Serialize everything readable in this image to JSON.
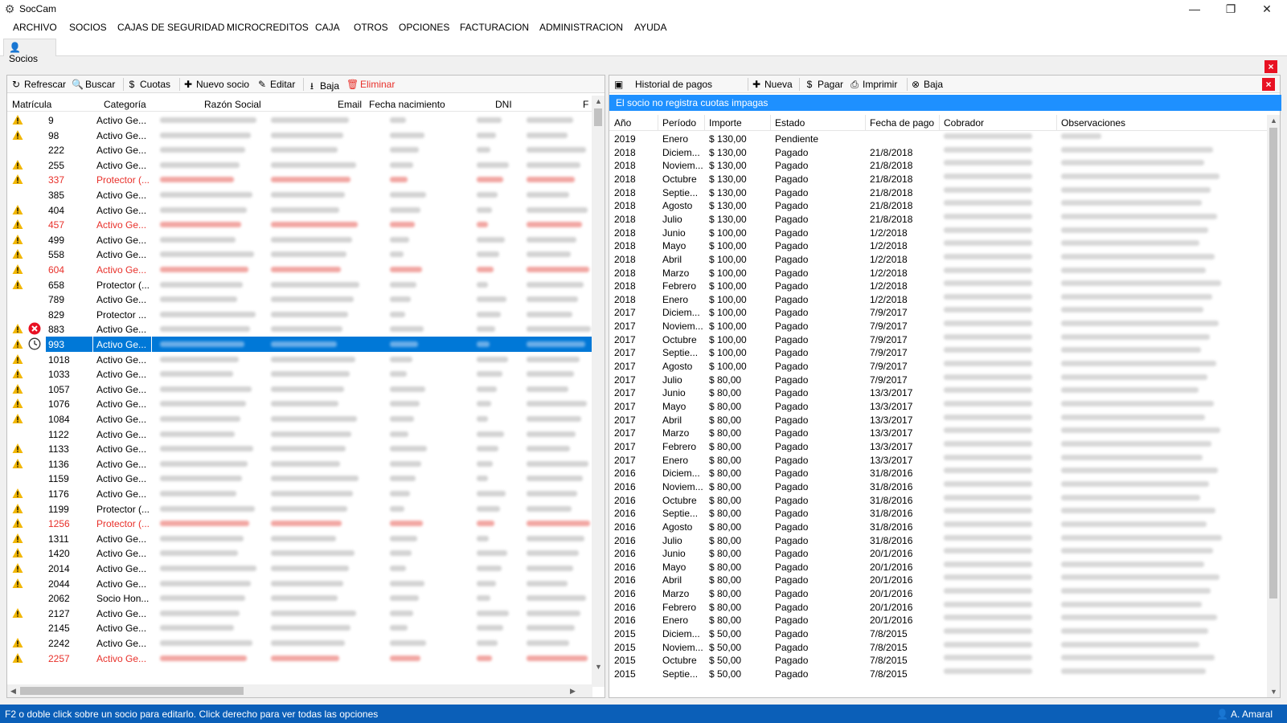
{
  "window": {
    "title": "SocCam",
    "minimize": "—",
    "restore": "❐",
    "close": "✕"
  },
  "menu": [
    "ARCHIVO",
    "SOCIOS",
    "CAJAS DE SEGURIDAD",
    "MICROCREDITOS",
    "CAJA",
    "OTROS",
    "OPCIONES",
    "FACTURACION",
    "ADMINISTRACION",
    "AYUDA"
  ],
  "tab": {
    "label": "Socios",
    "icon": "user-icon"
  },
  "left": {
    "toolbar": {
      "refresh": "Refrescar",
      "search": "Buscar",
      "fees": "Cuotas",
      "new": "Nuevo socio",
      "edit": "Editar",
      "deactivate": "Baja",
      "delete": "Eliminar"
    },
    "columns": [
      "Matrícula",
      "Categoría",
      "Razón Social",
      "Email",
      "Fecha nacimiento",
      "DNI",
      "F"
    ],
    "rows": [
      {
        "mat": "9",
        "cat": "Activo Ge...",
        "warn": true,
        "red": false,
        "extra": ""
      },
      {
        "mat": "98",
        "cat": "Activo Ge...",
        "warn": true,
        "red": false,
        "extra": ""
      },
      {
        "mat": "222",
        "cat": "Activo Ge...",
        "warn": false,
        "red": false,
        "extra": ""
      },
      {
        "mat": "255",
        "cat": "Activo Ge...",
        "warn": true,
        "red": false,
        "extra": ""
      },
      {
        "mat": "337",
        "cat": "Protector (...",
        "warn": true,
        "red": true,
        "extra": ""
      },
      {
        "mat": "385",
        "cat": "Activo Ge...",
        "warn": false,
        "red": false,
        "extra": ""
      },
      {
        "mat": "404",
        "cat": "Activo Ge...",
        "warn": true,
        "red": false,
        "extra": ""
      },
      {
        "mat": "457",
        "cat": "Activo Ge...",
        "warn": true,
        "red": true,
        "extra": ""
      },
      {
        "mat": "499",
        "cat": "Activo Ge...",
        "warn": true,
        "red": false,
        "extra": ""
      },
      {
        "mat": "558",
        "cat": "Activo Ge...",
        "warn": true,
        "red": false,
        "extra": ""
      },
      {
        "mat": "604",
        "cat": "Activo Ge...",
        "warn": true,
        "red": true,
        "extra": ""
      },
      {
        "mat": "658",
        "cat": "Protector (...",
        "warn": true,
        "red": false,
        "extra": ""
      },
      {
        "mat": "789",
        "cat": "Activo Ge...",
        "warn": false,
        "red": false,
        "extra": ""
      },
      {
        "mat": "829",
        "cat": "Protector ...",
        "warn": false,
        "red": false,
        "extra": ""
      },
      {
        "mat": "883",
        "cat": "Activo Ge...",
        "warn": true,
        "red": false,
        "extra": "error"
      },
      {
        "mat": "993",
        "cat": "Activo Ge...",
        "warn": true,
        "red": false,
        "extra": "clock",
        "selected": true
      },
      {
        "mat": "1018",
        "cat": "Activo Ge...",
        "warn": true,
        "red": false,
        "extra": ""
      },
      {
        "mat": "1033",
        "cat": "Activo Ge...",
        "warn": true,
        "red": false,
        "extra": ""
      },
      {
        "mat": "1057",
        "cat": "Activo Ge...",
        "warn": true,
        "red": false,
        "extra": ""
      },
      {
        "mat": "1076",
        "cat": "Activo Ge...",
        "warn": true,
        "red": false,
        "extra": ""
      },
      {
        "mat": "1084",
        "cat": "Activo Ge...",
        "warn": true,
        "red": false,
        "extra": ""
      },
      {
        "mat": "1122",
        "cat": "Activo Ge...",
        "warn": false,
        "red": false,
        "extra": ""
      },
      {
        "mat": "1133",
        "cat": "Activo Ge...",
        "warn": true,
        "red": false,
        "extra": ""
      },
      {
        "mat": "1136",
        "cat": "Activo Ge...",
        "warn": true,
        "red": false,
        "extra": ""
      },
      {
        "mat": "1159",
        "cat": "Activo Ge...",
        "warn": false,
        "red": false,
        "extra": ""
      },
      {
        "mat": "1176",
        "cat": "Activo Ge...",
        "warn": true,
        "red": false,
        "extra": ""
      },
      {
        "mat": "1199",
        "cat": "Protector (...",
        "warn": true,
        "red": false,
        "extra": ""
      },
      {
        "mat": "1256",
        "cat": "Protector (...",
        "warn": true,
        "red": true,
        "extra": ""
      },
      {
        "mat": "1311",
        "cat": "Activo Ge...",
        "warn": true,
        "red": false,
        "extra": ""
      },
      {
        "mat": "1420",
        "cat": "Activo Ge...",
        "warn": true,
        "red": false,
        "extra": ""
      },
      {
        "mat": "2014",
        "cat": "Activo Ge...",
        "warn": true,
        "red": false,
        "extra": ""
      },
      {
        "mat": "2044",
        "cat": "Activo Ge...",
        "warn": true,
        "red": false,
        "extra": ""
      },
      {
        "mat": "2062",
        "cat": "Socio Hon...",
        "warn": false,
        "red": false,
        "extra": ""
      },
      {
        "mat": "2127",
        "cat": "Activo Ge...",
        "warn": true,
        "red": false,
        "extra": ""
      },
      {
        "mat": "2145",
        "cat": "Activo Ge...",
        "warn": false,
        "red": false,
        "extra": ""
      },
      {
        "mat": "2242",
        "cat": "Activo Ge...",
        "warn": true,
        "red": false,
        "extra": ""
      },
      {
        "mat": "2257",
        "cat": "Activo Ge...",
        "warn": true,
        "red": true,
        "extra": ""
      }
    ]
  },
  "right": {
    "toolbar": {
      "title": "Historial de pagos",
      "new": "Nueva",
      "pay": "Pagar",
      "print": "Imprimir",
      "deactivate": "Baja"
    },
    "banner": "El socio no registra cuotas impagas",
    "columns": [
      "Año",
      "Período",
      "Importe",
      "Estado",
      "Fecha de pago",
      "Cobrador",
      "Observaciones"
    ],
    "rows": [
      [
        "2019",
        "Enero",
        "$ 130,00",
        "Pendiente",
        ""
      ],
      [
        "2018",
        "Diciem...",
        "$ 130,00",
        "Pagado",
        "21/8/2018"
      ],
      [
        "2018",
        "Noviem...",
        "$ 130,00",
        "Pagado",
        "21/8/2018"
      ],
      [
        "2018",
        "Octubre",
        "$ 130,00",
        "Pagado",
        "21/8/2018"
      ],
      [
        "2018",
        "Septie...",
        "$ 130,00",
        "Pagado",
        "21/8/2018"
      ],
      [
        "2018",
        "Agosto",
        "$ 130,00",
        "Pagado",
        "21/8/2018"
      ],
      [
        "2018",
        "Julio",
        "$ 130,00",
        "Pagado",
        "21/8/2018"
      ],
      [
        "2018",
        "Junio",
        "$ 100,00",
        "Pagado",
        "1/2/2018"
      ],
      [
        "2018",
        "Mayo",
        "$ 100,00",
        "Pagado",
        "1/2/2018"
      ],
      [
        "2018",
        "Abril",
        "$ 100,00",
        "Pagado",
        "1/2/2018"
      ],
      [
        "2018",
        "Marzo",
        "$ 100,00",
        "Pagado",
        "1/2/2018"
      ],
      [
        "2018",
        "Febrero",
        "$ 100,00",
        "Pagado",
        "1/2/2018"
      ],
      [
        "2018",
        "Enero",
        "$ 100,00",
        "Pagado",
        "1/2/2018"
      ],
      [
        "2017",
        "Diciem...",
        "$ 100,00",
        "Pagado",
        "7/9/2017"
      ],
      [
        "2017",
        "Noviem...",
        "$ 100,00",
        "Pagado",
        "7/9/2017"
      ],
      [
        "2017",
        "Octubre",
        "$ 100,00",
        "Pagado",
        "7/9/2017"
      ],
      [
        "2017",
        "Septie...",
        "$ 100,00",
        "Pagado",
        "7/9/2017"
      ],
      [
        "2017",
        "Agosto",
        "$ 100,00",
        "Pagado",
        "7/9/2017"
      ],
      [
        "2017",
        "Julio",
        "$ 80,00",
        "Pagado",
        "7/9/2017"
      ],
      [
        "2017",
        "Junio",
        "$ 80,00",
        "Pagado",
        "13/3/2017"
      ],
      [
        "2017",
        "Mayo",
        "$ 80,00",
        "Pagado",
        "13/3/2017"
      ],
      [
        "2017",
        "Abril",
        "$ 80,00",
        "Pagado",
        "13/3/2017"
      ],
      [
        "2017",
        "Marzo",
        "$ 80,00",
        "Pagado",
        "13/3/2017"
      ],
      [
        "2017",
        "Febrero",
        "$ 80,00",
        "Pagado",
        "13/3/2017"
      ],
      [
        "2017",
        "Enero",
        "$ 80,00",
        "Pagado",
        "13/3/2017"
      ],
      [
        "2016",
        "Diciem...",
        "$ 80,00",
        "Pagado",
        "31/8/2016"
      ],
      [
        "2016",
        "Noviem...",
        "$ 80,00",
        "Pagado",
        "31/8/2016"
      ],
      [
        "2016",
        "Octubre",
        "$ 80,00",
        "Pagado",
        "31/8/2016"
      ],
      [
        "2016",
        "Septie...",
        "$ 80,00",
        "Pagado",
        "31/8/2016"
      ],
      [
        "2016",
        "Agosto",
        "$ 80,00",
        "Pagado",
        "31/8/2016"
      ],
      [
        "2016",
        "Julio",
        "$ 80,00",
        "Pagado",
        "31/8/2016"
      ],
      [
        "2016",
        "Junio",
        "$ 80,00",
        "Pagado",
        "20/1/2016"
      ],
      [
        "2016",
        "Mayo",
        "$ 80,00",
        "Pagado",
        "20/1/2016"
      ],
      [
        "2016",
        "Abril",
        "$ 80,00",
        "Pagado",
        "20/1/2016"
      ],
      [
        "2016",
        "Marzo",
        "$ 80,00",
        "Pagado",
        "20/1/2016"
      ],
      [
        "2016",
        "Febrero",
        "$ 80,00",
        "Pagado",
        "20/1/2016"
      ],
      [
        "2016",
        "Enero",
        "$ 80,00",
        "Pagado",
        "20/1/2016"
      ],
      [
        "2015",
        "Diciem...",
        "$ 50,00",
        "Pagado",
        "7/8/2015"
      ],
      [
        "2015",
        "Noviem...",
        "$ 50,00",
        "Pagado",
        "7/8/2015"
      ],
      [
        "2015",
        "Octubre",
        "$ 50,00",
        "Pagado",
        "7/8/2015"
      ],
      [
        "2015",
        "Septie...",
        "$ 50,00",
        "Pagado",
        "7/8/2015"
      ]
    ]
  },
  "status": {
    "message": "F2 o doble click sobre un socio para editarlo. Click derecho para ver todas las opciones",
    "user": "A. Amaral"
  },
  "colors": {
    "selection": "#0078d7",
    "banner": "#1e90ff",
    "statusbar": "#0b5fb8",
    "danger": "#e8302a",
    "warning": "#f2b705"
  }
}
